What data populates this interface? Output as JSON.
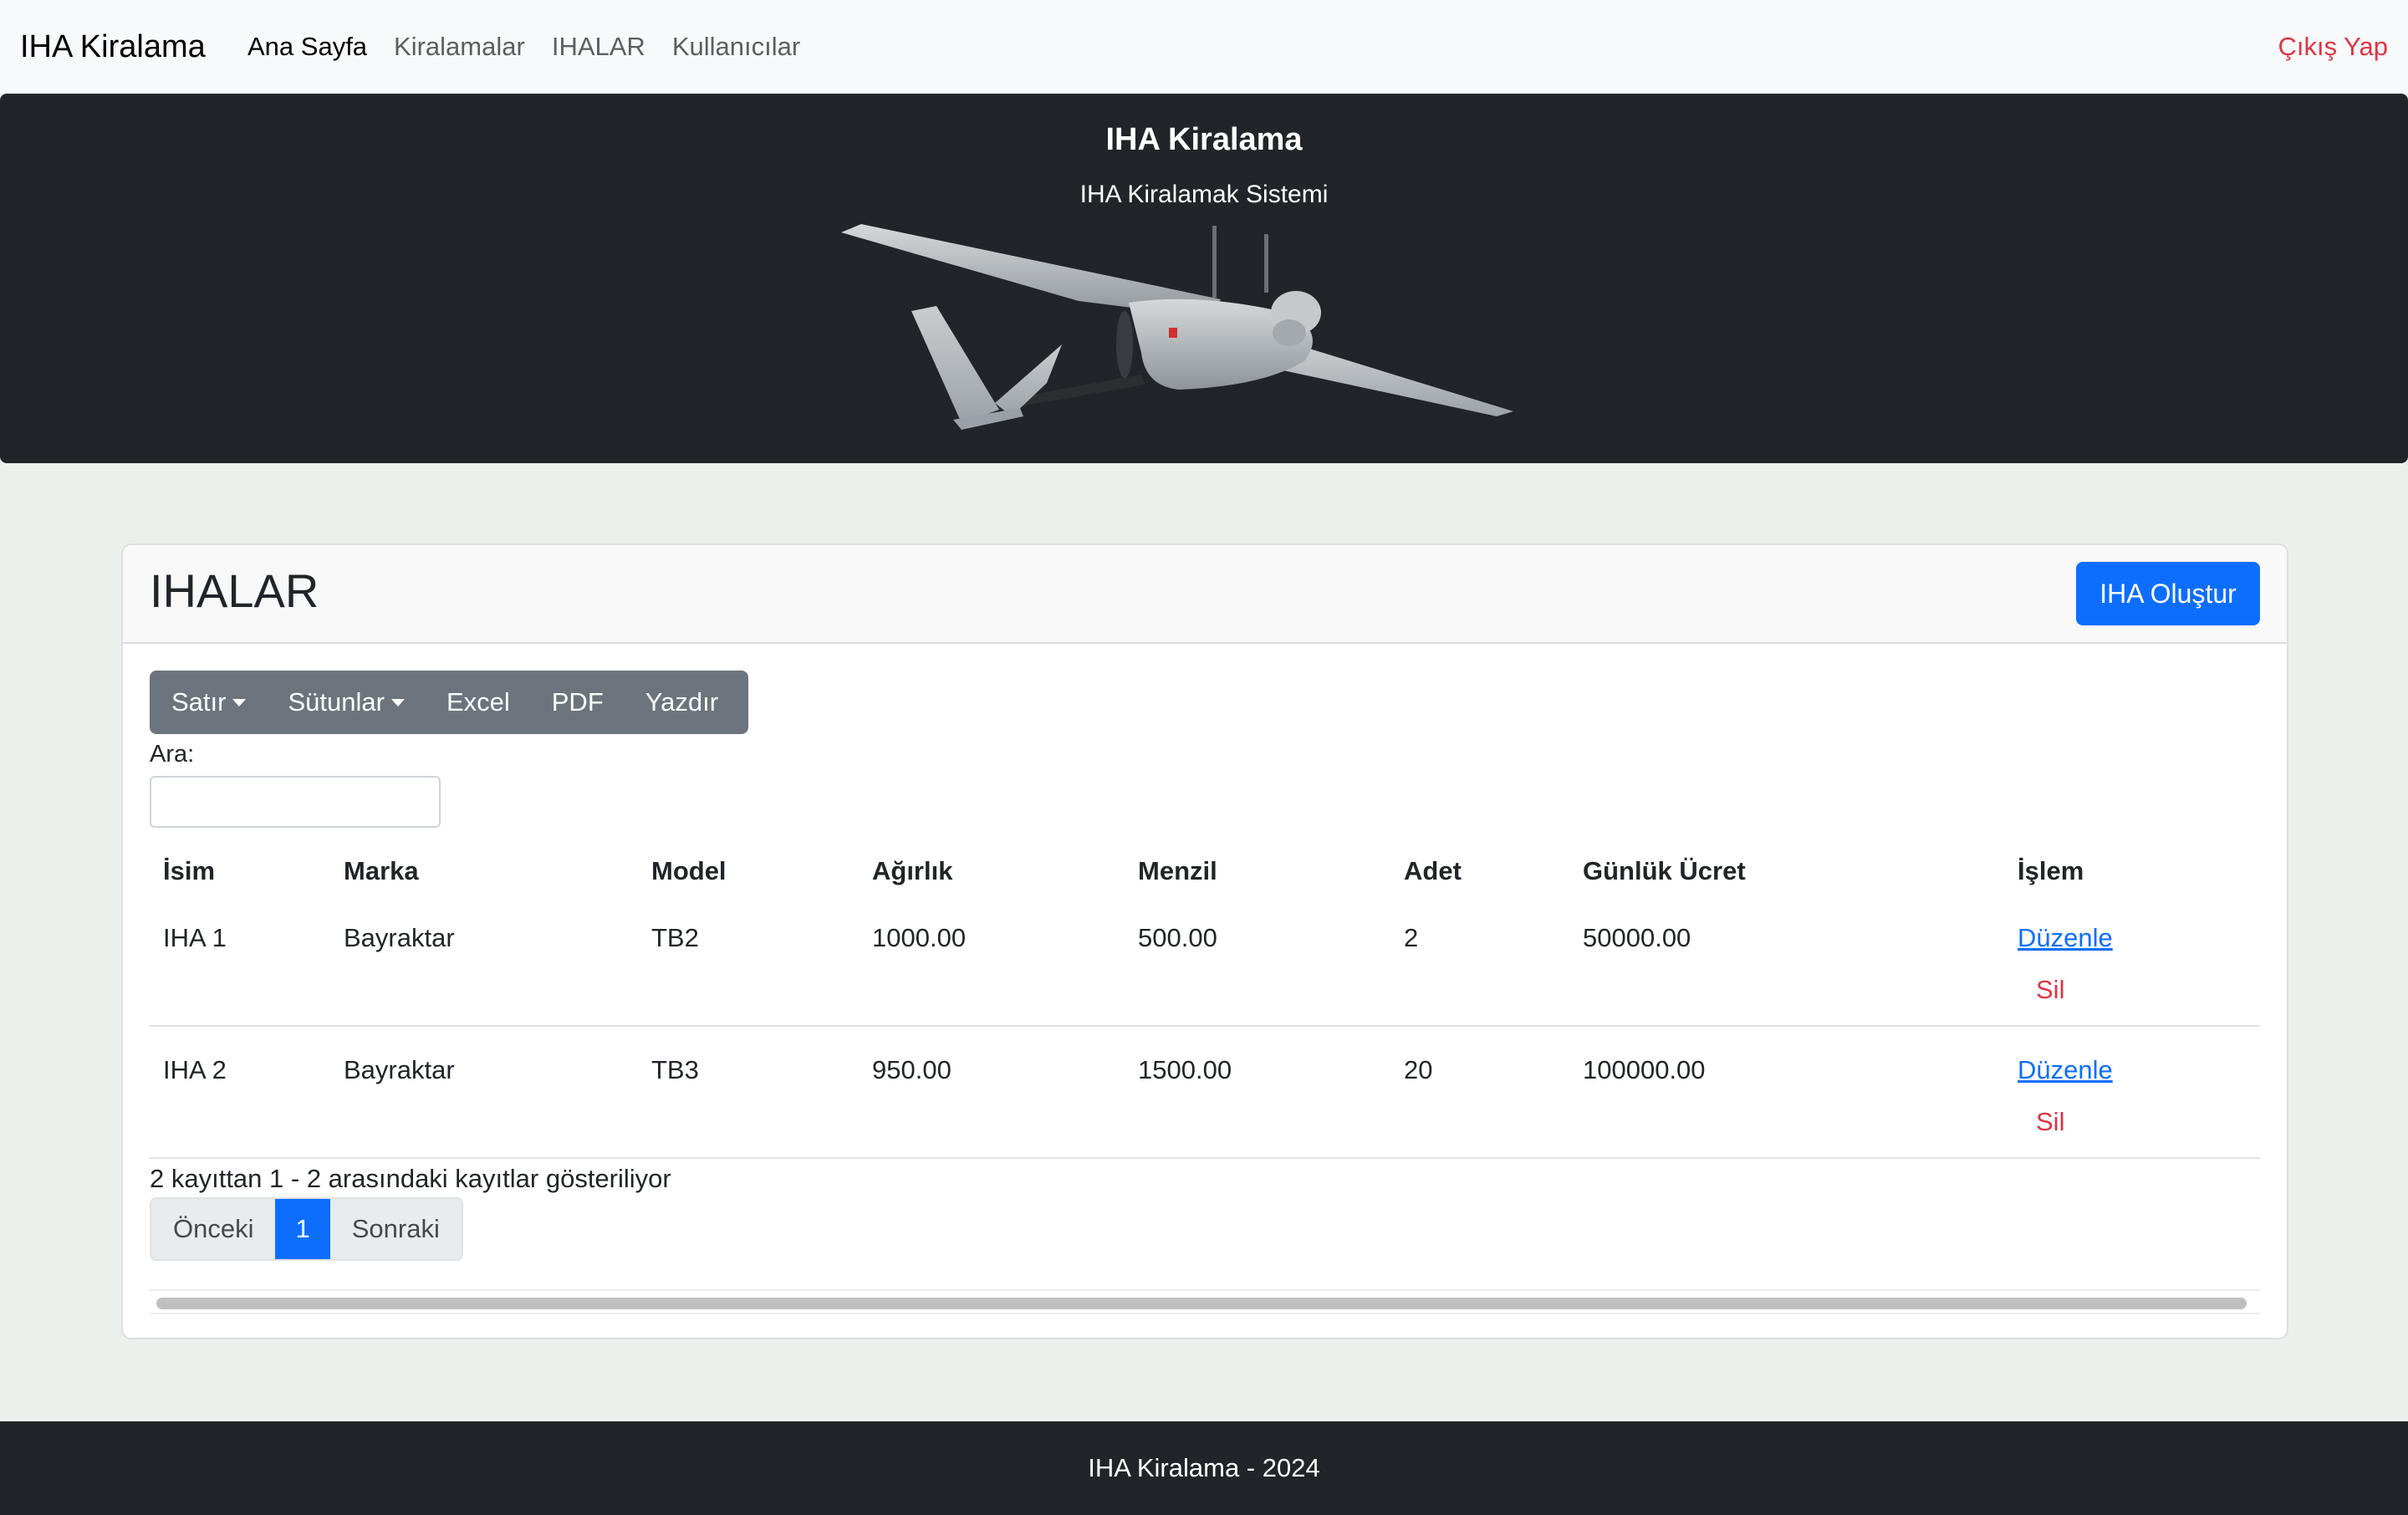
{
  "navbar": {
    "brand": "IHA Kiralama",
    "links": [
      "Ana Sayfa",
      "Kiralamalar",
      "IHALAR",
      "Kullanıcılar"
    ],
    "logout": "Çıkış Yap"
  },
  "hero": {
    "title": "IHA Kiralama",
    "subtitle": "IHA Kiralamak Sistemi"
  },
  "card": {
    "title": "IHALAR",
    "create_button": "IHA Oluştur"
  },
  "toolbar": {
    "rows": "Satır",
    "columns": "Sütunlar",
    "excel": "Excel",
    "pdf": "PDF",
    "print": "Yazdır"
  },
  "search": {
    "label": "Ara:",
    "value": ""
  },
  "table": {
    "headers": [
      "İsim",
      "Marka",
      "Model",
      "Ağırlık",
      "Menzil",
      "Adet",
      "Günlük Ücret",
      "İşlem"
    ],
    "rows": [
      [
        "IHA 1",
        "Bayraktar",
        "TB2",
        "1000.00",
        "500.00",
        "2",
        "50000.00"
      ],
      [
        "IHA 2",
        "Bayraktar",
        "TB3",
        "950.00",
        "1500.00",
        "20",
        "100000.00"
      ]
    ],
    "edit_label": "Düzenle",
    "delete_label": "Sil"
  },
  "info": "2 kayıttan 1 - 2 arasındaki kayıtlar gösteriliyor",
  "pagination": {
    "prev": "Önceki",
    "current": "1",
    "next": "Sonraki"
  },
  "footer": "IHA Kiralama - 2024",
  "colors": {
    "primary": "#0d6efd",
    "danger": "#dc3545",
    "dark": "#212529",
    "secondary": "#6c757d"
  }
}
